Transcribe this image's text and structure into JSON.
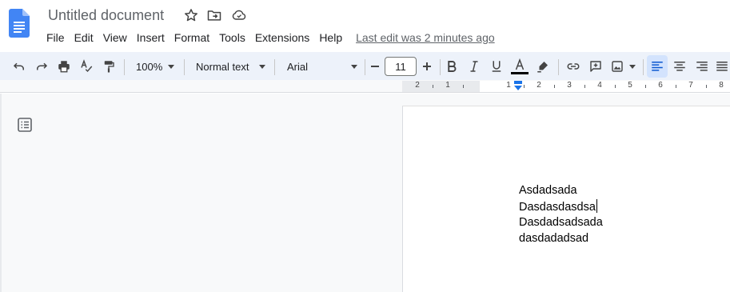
{
  "app": {
    "title": "Untitled document",
    "menu": [
      "File",
      "Edit",
      "View",
      "Insert",
      "Format",
      "Tools",
      "Extensions",
      "Help"
    ],
    "last_edit": "Last edit was 2 minutes ago"
  },
  "toolbar": {
    "zoom": "100%",
    "style": "Normal text",
    "font": "Arial",
    "font_size": "11",
    "text_color": "#000000"
  },
  "ruler": {
    "numbers": [
      "2",
      "1",
      "1",
      "2",
      "3",
      "4",
      "5",
      "6",
      "7",
      "8"
    ]
  },
  "document": {
    "lines": [
      "Asdadsada",
      "Dasdasdasdsa",
      "Dasdadsadsada",
      "dasdadadsad"
    ]
  },
  "colors": {
    "accent": "#1a73e8",
    "toolbar_bg": "#edf2fa",
    "active_button": "#d3e3fd"
  }
}
